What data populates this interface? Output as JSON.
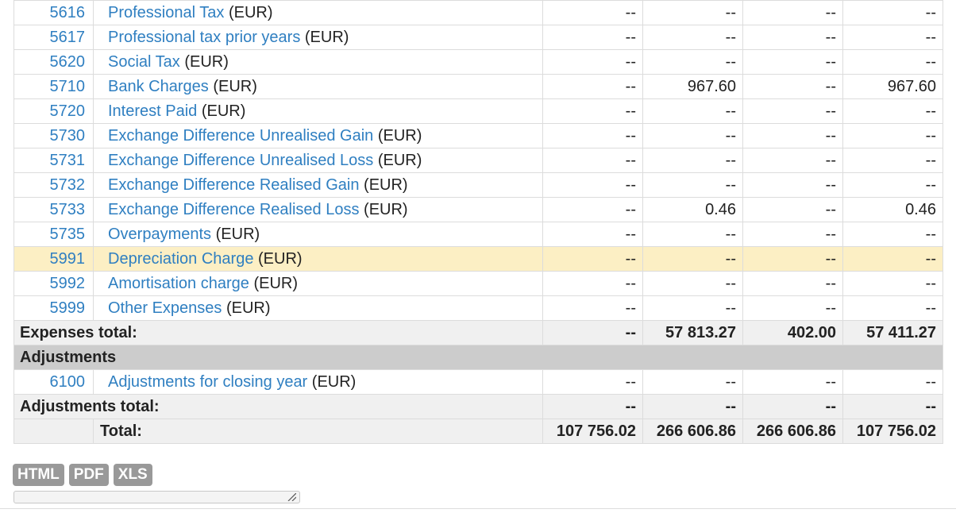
{
  "rows": [
    {
      "code": "5616",
      "name": "Professional Tax",
      "cur": "(EUR)",
      "v": [
        "--",
        "--",
        "--",
        "--"
      ]
    },
    {
      "code": "5617",
      "name": "Professional tax prior years",
      "cur": "(EUR)",
      "v": [
        "--",
        "--",
        "--",
        "--"
      ]
    },
    {
      "code": "5620",
      "name": "Social Tax",
      "cur": "(EUR)",
      "v": [
        "--",
        "--",
        "--",
        "--"
      ]
    },
    {
      "code": "5710",
      "name": "Bank Charges",
      "cur": "(EUR)",
      "v": [
        "--",
        "967.60",
        "--",
        "967.60"
      ]
    },
    {
      "code": "5720",
      "name": "Interest Paid",
      "cur": "(EUR)",
      "v": [
        "--",
        "--",
        "--",
        "--"
      ]
    },
    {
      "code": "5730",
      "name": "Exchange Difference Unrealised Gain",
      "cur": "(EUR)",
      "v": [
        "--",
        "--",
        "--",
        "--"
      ]
    },
    {
      "code": "5731",
      "name": "Exchange Difference Unrealised Loss",
      "cur": "(EUR)",
      "v": [
        "--",
        "--",
        "--",
        "--"
      ]
    },
    {
      "code": "5732",
      "name": "Exchange Difference Realised Gain",
      "cur": "(EUR)",
      "v": [
        "--",
        "--",
        "--",
        "--"
      ]
    },
    {
      "code": "5733",
      "name": "Exchange Difference Realised Loss",
      "cur": "(EUR)",
      "v": [
        "--",
        "0.46",
        "--",
        "0.46"
      ]
    },
    {
      "code": "5735",
      "name": "Overpayments",
      "cur": "(EUR)",
      "v": [
        "--",
        "--",
        "--",
        "--"
      ]
    },
    {
      "code": "5991",
      "name": "Depreciation Charge",
      "cur": "(EUR)",
      "v": [
        "--",
        "--",
        "--",
        "--"
      ]
    },
    {
      "code": "5992",
      "name": "Amortisation charge",
      "cur": "(EUR)",
      "v": [
        "--",
        "--",
        "--",
        "--"
      ]
    },
    {
      "code": "5999",
      "name": "Other Expenses",
      "cur": "(EUR)",
      "v": [
        "--",
        "--",
        "--",
        "--"
      ]
    }
  ],
  "expenses_total": {
    "label": "Expenses total:",
    "v": [
      "--",
      "57 813.27",
      "402.00",
      "57 411.27"
    ]
  },
  "adjustments": {
    "title": "Adjustments",
    "row": {
      "code": "6100",
      "name": "Adjustments for closing year",
      "cur": "(EUR)",
      "v": [
        "--",
        "--",
        "--",
        "--"
      ]
    },
    "total": {
      "label": "Adjustments total:",
      "v": [
        "--",
        "--",
        "--",
        "--"
      ]
    }
  },
  "grand_total": {
    "label": "Total:",
    "v": [
      "107 756.02",
      "266 606.86",
      "266 606.86",
      "107 756.02"
    ]
  },
  "exports": [
    "HTML",
    "PDF",
    "XLS"
  ],
  "colors": {
    "link": "#2f7fc1",
    "highlight_row": "#fcefc4",
    "section_bg": "#cccccc",
    "button_bg": "#999999"
  }
}
